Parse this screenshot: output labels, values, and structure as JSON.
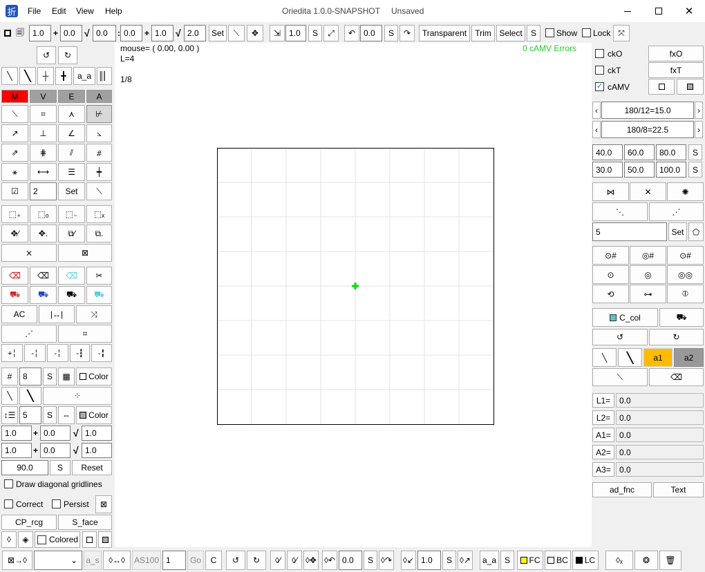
{
  "window": {
    "title": "Oriedita 1.0.0-SNAPSHOT",
    "state": "Unsaved"
  },
  "menu": [
    "File",
    "Edit",
    "View",
    "Help"
  ],
  "toolbar": {
    "grid_scale": "1.0",
    "grid_dx": "0.0",
    "grid_sqrt": "0.0",
    "grid_dy": "0.0",
    "grid_dy2": "1.0",
    "grid_sqrt2": "2.0",
    "set": "Set",
    "scale": "1.0",
    "scale_s": "S",
    "rotate": "0.0",
    "rotate_s": "S",
    "transparent": "Transparent",
    "trim": "Trim",
    "select": "Select",
    "s": "S",
    "show": "Show",
    "lock": "Lock"
  },
  "canvas": {
    "mouse": "mouse= ( 0.00, 0.00 )",
    "length": "L=4",
    "fraction": "1/8",
    "errors": "0 cAMV Errors",
    "error_color": "#22cc22",
    "center_color": "#00dd00"
  },
  "left": {
    "aa": "a_a",
    "modes": [
      "M",
      "V",
      "E",
      "A"
    ],
    "num": "2",
    "set": "Set",
    "ac": "AC",
    "grid_count": "8",
    "s": "S",
    "color": "Color",
    "interval": "5",
    "m1": "1.0",
    "m2": "0.0",
    "m3": "1.0",
    "m4": "1.0",
    "m5": "0.0",
    "m6": "1.0",
    "angle": "90.0",
    "reset": "Reset",
    "diag": "Draw diagonal gridlines",
    "correct": "Correct",
    "persist": "Persist",
    "cp_rcg": "CP_rcg",
    "s_face": "S_face",
    "colored": "Colored"
  },
  "right": {
    "cko": "ckO",
    "ckt": "ckT",
    "camv": "cAMV",
    "fxo": "fxO",
    "fxt": "fxT",
    "div1": "180/12=15.0",
    "div2": "180/8=22.5",
    "a1": "40.0",
    "a2": "60.0",
    "a3": "80.0",
    "a4": "30.0",
    "a5": "50.0",
    "a6": "100.0",
    "poly": "5",
    "set": "Set",
    "s": "S",
    "c_col": "C_col",
    "tab_a1": "a1",
    "tab_a2": "a2",
    "l1": "L1=",
    "l2": "L2=",
    "a1l": "A1=",
    "a2l": "A2=",
    "a3l": "A3=",
    "v": "0.0",
    "ad_fnc": "ad_fnc",
    "text": "Text"
  },
  "bottom": {
    "a_s": "a_s",
    "as100": "AS100",
    "num": "1",
    "go": "Go",
    "c": "C",
    "v1": "0.0",
    "s": "S",
    "v2": "1.0",
    "aa": "a_a",
    "fc": "FC",
    "bc": "BC",
    "lc": "LC",
    "fc_color": "#ffff00",
    "lc_color": "#000000"
  },
  "colors": {
    "m_red": "#ff0000",
    "a_gray": "#a0a0a0",
    "a1_yellow": "#ffbb00",
    "a2_gray": "#999999",
    "c_col": "#5fc1c8"
  }
}
